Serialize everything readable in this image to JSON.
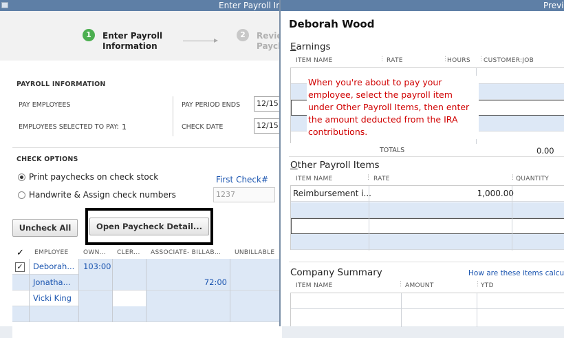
{
  "back_window": {
    "title": "Enter Payroll In",
    "steps": [
      {
        "number": "1",
        "label": "Enter Payroll\nInformation"
      },
      {
        "number": "2",
        "label": "Revie\nPaych"
      }
    ],
    "payroll_info": {
      "section_title": "PAYROLL INFORMATION",
      "pay_employees_label": "PAY EMPLOYEES",
      "employees_selected_label": "EMPLOYEES SELECTED TO PAY:",
      "employees_selected_value": "1",
      "pay_period_ends_label": "PAY PERIOD ENDS",
      "pay_period_ends_value": "12/15",
      "check_date_label": "CHECK DATE",
      "check_date_value": "12/15"
    },
    "check_options": {
      "section_title": "CHECK OPTIONS",
      "print_option": "Print paychecks on check stock",
      "handwrite_option": "Handwrite & Assign check numbers",
      "first_check_label": "First Check#",
      "first_check_value": "1237"
    },
    "buttons": {
      "uncheck_all": "Uncheck All",
      "open_paycheck_detail": "Open Paycheck Detail..."
    },
    "grid": {
      "check_header": "✓",
      "headers": [
        "EMPLOYEE",
        "OWN...",
        "CLER...",
        "ASSOCIATE- BILLAB...",
        "UNBILLABLE"
      ],
      "rows": [
        {
          "checked": "✓",
          "employee": "Deborah...",
          "own": "103:00",
          "cler": "",
          "assoc": "",
          "unbill": ""
        },
        {
          "checked": "",
          "employee": "Jonatha...",
          "own": "",
          "cler": "",
          "assoc": "72:00",
          "unbill": ""
        },
        {
          "checked": "",
          "employee": "Vicki King",
          "own": "",
          "cler": "",
          "assoc": "",
          "unbill": ""
        },
        {
          "checked": "",
          "employee": "",
          "own": "",
          "cler": "",
          "assoc": "",
          "unbill": ""
        }
      ]
    }
  },
  "front_window": {
    "title": "Previe",
    "employee_name": "Deborah Wood",
    "earnings": {
      "title_first": "E",
      "title_rest": "arnings",
      "headers": [
        "ITEM NAME",
        "RATE",
        "HOURS",
        "CUSTOMER:JOB"
      ],
      "totals_label": "TOTALS",
      "totals_value": "0.00"
    },
    "other_payroll": {
      "title_first": "O",
      "title_rest": "ther Payroll Items",
      "headers": [
        "ITEM NAME",
        "RATE",
        "QUANTITY"
      ],
      "rows": [
        {
          "item": "Reimbursement i...",
          "rate": "1,000.00"
        }
      ]
    },
    "company_summary": {
      "title": "Company Summary",
      "help_link": "How are these items calculat",
      "headers": [
        "ITEM NAME",
        "AMOUNT",
        "YTD"
      ]
    },
    "annotation": "When you're about to pay your employee, select the payroll item under Other Payroll Items, then enter the amount deducted from the IRA contributions."
  },
  "colors": {
    "titlebar": "#5e7fa6",
    "step_active": "#4caf50",
    "step_inactive": "#c8c8c8",
    "row_stripe": "#dde8f6",
    "link_blue": "#1b55b0",
    "annotation_red": "#d00000"
  }
}
